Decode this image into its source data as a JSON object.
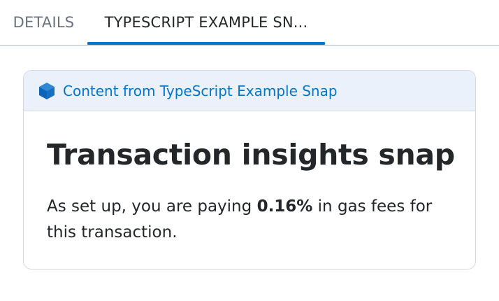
{
  "tabs": [
    {
      "label": "DETAILS",
      "active": false
    },
    {
      "label": "TYPESCRIPT EXAMPLE SN...",
      "active": true
    }
  ],
  "colors": {
    "accent": "#0376c9",
    "header_bg": "#eaf1fa",
    "border": "#d6d9dc",
    "text": "#24272a",
    "muted": "#6a737d"
  },
  "snap_card": {
    "header_icon": "cube-icon",
    "header_text": "Content from TypeScript Example Snap",
    "title": "Transaction insights snap",
    "body": {
      "prefix": "As set up, you are paying ",
      "highlight": "0.16%",
      "suffix": " in gas fees for this transaction."
    }
  }
}
